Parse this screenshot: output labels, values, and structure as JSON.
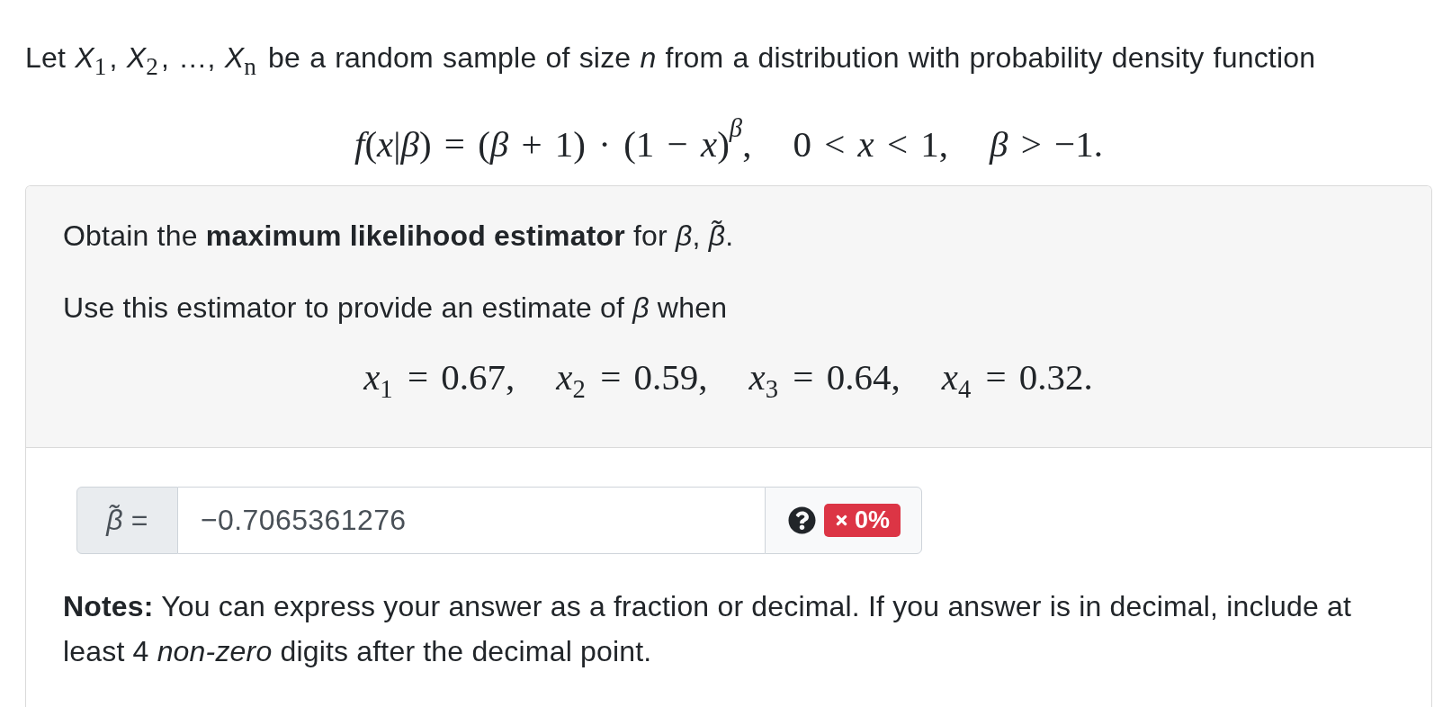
{
  "intro": {
    "text": "Let *X*$_{1}$, *X*$_{2}$, …, *X*$_{n}$ be a random sample of size *n* from a distribution with probability density function"
  },
  "pdf_formula": {
    "terms": [
      "*f*(*x*|*β*) = (*β* + 1) · (1 − *x*)$^{β}$,",
      "0 < *x* < 1,",
      "*β* > −1."
    ]
  },
  "question": {
    "paragraphs": [
      "Obtain the **maximum likelihood estimator** for *β*, *β̃*.",
      "Use this estimator to provide an estimate of *β* when"
    ],
    "data_formula": {
      "terms": [
        "*x*$_{1}$ = 0.67,",
        "*x*$_{2}$ = 0.59,",
        "*x*$_{3}$ = 0.64,",
        "*x*$_{4}$ = 0.32."
      ]
    }
  },
  "answer": {
    "label": "*β̃* =",
    "value": "−0.7065361276",
    "score_badge": {
      "text": "0%",
      "correct": false
    }
  },
  "notes": "**Notes:** You can express your answer as a fraction or decimal. If you answer is in decimal, include at least 4 *non-zero* digits after the decimal point."
}
